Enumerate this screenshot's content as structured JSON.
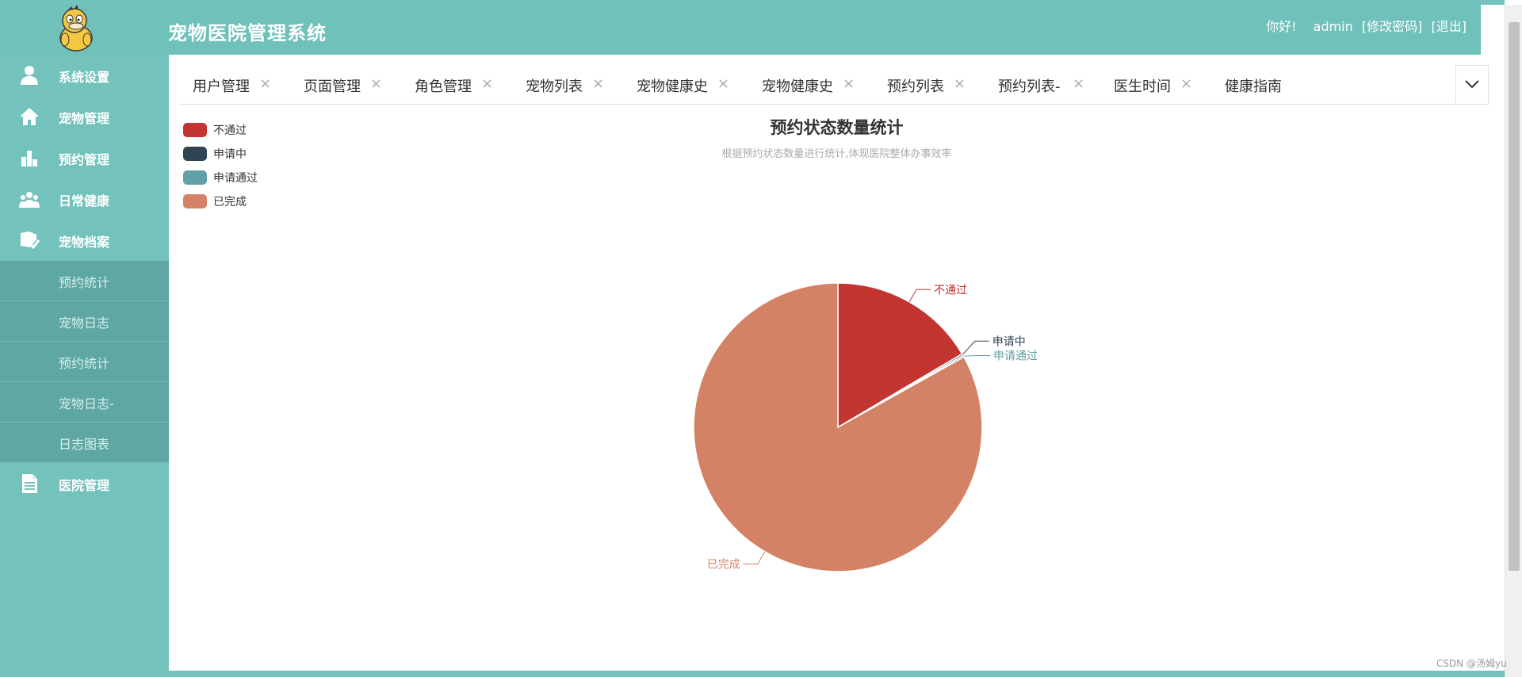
{
  "header": {
    "title": "宠物医院管理系统",
    "greeting": "你好!",
    "username": "admin",
    "change_password": "[修改密码]",
    "logout": "[退出]"
  },
  "sidebar": {
    "items": [
      {
        "label": "系统设置",
        "icon": "user-settings-icon"
      },
      {
        "label": "宠物管理",
        "icon": "home-icon"
      },
      {
        "label": "预约管理",
        "icon": "bar-chart-icon"
      },
      {
        "label": "日常健康",
        "icon": "group-icon"
      },
      {
        "label": "宠物档案",
        "icon": "folder-check-icon"
      }
    ],
    "sub_items": [
      {
        "label": "预约统计"
      },
      {
        "label": "宠物日志"
      },
      {
        "label": "预约统计"
      },
      {
        "label": "宠物日志-"
      },
      {
        "label": "日志图表"
      }
    ],
    "last_item": {
      "label": "医院管理",
      "icon": "document-icon"
    }
  },
  "tabs": [
    {
      "label": "用户管理",
      "close": "×"
    },
    {
      "label": "页面管理",
      "close": "×"
    },
    {
      "label": "角色管理",
      "close": "×"
    },
    {
      "label": "宠物列表",
      "close": "×"
    },
    {
      "label": "宠物健康史",
      "close": "×"
    },
    {
      "label": "宠物健康史",
      "close": "×"
    },
    {
      "label": "预约列表",
      "close": "×"
    },
    {
      "label": "预约列表-",
      "close": "×"
    },
    {
      "label": "医生时间",
      "close": "×"
    },
    {
      "label": "健康指南",
      "close": ""
    }
  ],
  "chart_data": {
    "type": "pie",
    "title": "预约状态数量统计",
    "subtitle": "根据预约状态数量进行统计,体现医院整体办事效率",
    "legend_position": "top-left",
    "series": [
      {
        "name": "不通过",
        "value": 16.5,
        "color": "#c23531"
      },
      {
        "name": "申请中",
        "value": 0.2,
        "color": "#2f4554"
      },
      {
        "name": "申请通过",
        "value": 0.2,
        "color": "#61a0a8"
      },
      {
        "name": "已完成",
        "value": 83.1,
        "color": "#d48265"
      }
    ]
  },
  "watermark": "CSDN @汤姆yu",
  "colors": {
    "header_bg": "#6fc1ba",
    "sidebar_bg": "#74c2bc",
    "submenu_bg": "#5ea7a2"
  }
}
